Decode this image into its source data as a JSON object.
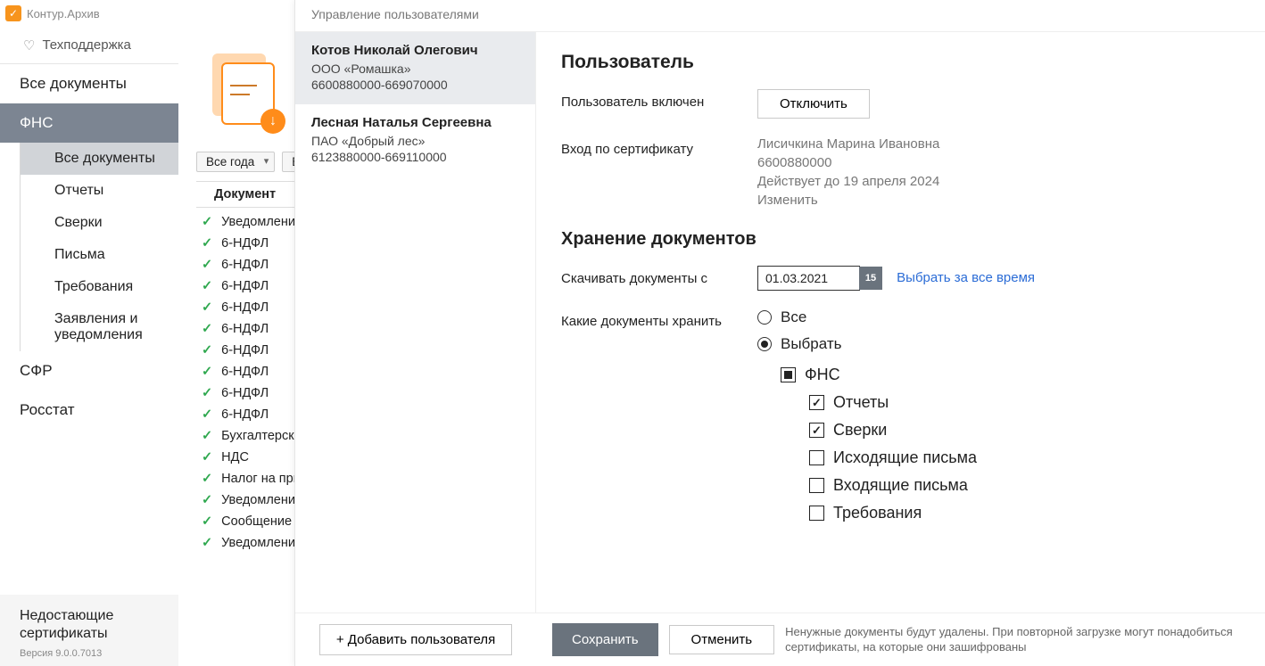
{
  "app": {
    "title": "Контур.Архив"
  },
  "support": {
    "label": "Техподдержка"
  },
  "sidebar": {
    "all_docs": "Все документы",
    "fns": "ФНС",
    "sub_all": "Все документы",
    "sub_reports": "Отчеты",
    "sub_recon": "Сверки",
    "sub_letters": "Письма",
    "sub_demands": "Требования",
    "sub_apps": "Заявления и уведомления",
    "sfr": "СФР",
    "rosstat": "Росстат",
    "missing_cert": "Недостающие сертификаты",
    "version": "Версия 9.0.0.7013"
  },
  "filters": {
    "year": "Все года",
    "extra": "В"
  },
  "table": {
    "col_doc": "Документ"
  },
  "docs": [
    "Уведомление о",
    "6-НДФЛ",
    "6-НДФЛ",
    "6-НДФЛ",
    "6-НДФЛ",
    "6-НДФЛ",
    "6-НДФЛ",
    "6-НДФЛ",
    "6-НДФЛ",
    "6-НДФЛ",
    "Бухгалтерская (",
    "НДС",
    "Налог на прибы",
    "Уведомление об",
    "Сообщение об о",
    "Уведомление о"
  ],
  "overlay": {
    "title": "Управление пользователями",
    "add_user": "+ Добавить пользователя",
    "users": [
      {
        "name": "Котов Николай Олегович",
        "company": "ООО «Ромашка»",
        "ids": "6600880000-669070000"
      },
      {
        "name": "Лесная Наталья Сергеевна",
        "company": "ПАО «Добрый лес»",
        "ids": "6123880000-669110000"
      }
    ],
    "detail": {
      "heading_user": "Пользователь",
      "enabled_label": "Пользователь включен",
      "disable_btn": "Отключить",
      "cert_login_label": "Вход по сертификату",
      "cert_name": "Лисичкина Марина Ивановна",
      "cert_num": "6600880000",
      "cert_valid": "Действует до 19 апреля 2024",
      "change_link": "Изменить",
      "heading_storage": "Хранение документов",
      "download_from_label": "Скачивать документы с",
      "date_value": "01.03.2021",
      "cal_text": "15",
      "select_all_time": "Выбрать за все время",
      "which_docs_label": "Какие документы хранить",
      "radio_all": "Все",
      "radio_select": "Выбрать",
      "tree": {
        "fns": "ФНС",
        "reports": "Отчеты",
        "recon": "Сверки",
        "out_letters": "Исходящие письма",
        "in_letters": "Входящие письма",
        "demands": "Требования"
      }
    },
    "footer": {
      "save": "Сохранить",
      "cancel": "Отменить",
      "note": "Ненужные документы будут удалены. При повторной загрузке могут понадобиться сертификаты, на которые они зашифрованы"
    }
  }
}
